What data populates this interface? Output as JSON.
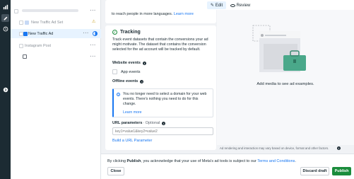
{
  "tree": {
    "items": [
      {
        "label": "New Traffic Ad Set"
      },
      {
        "label": "New Traffic Ad"
      },
      {
        "label": "Instagram Post"
      }
    ]
  },
  "editor": {
    "top_text": "to reach people in more languages.",
    "top_link": "Learn more",
    "tracking": {
      "title": "Tracking",
      "description": "Track event datasets that contain the conversions your ad might motivate. The dataset that contains the conversion selected for the ad account will be tracked by default.",
      "website_events": "Website events",
      "app_events": "App events",
      "offline_events": "Offline events",
      "notice": "You no longer need to select a domain for your web events. There's nothing you need to do for this change.",
      "notice_link": "Learn more",
      "url_params_label": "URL parameters",
      "url_params_optional": " · Optional",
      "url_params_placeholder": "key1=value1&key2=value2",
      "build_link": "Build a URL Parameter"
    }
  },
  "topbar": {
    "edit": "Edit",
    "review": "Review"
  },
  "preview": {
    "add_media": "Add media to see ad examples.",
    "note": "Ad rendering and interaction may vary based on device, format and other factors."
  },
  "footer": {
    "text_prefix": "By clicking ",
    "text_bold": "Publish",
    "text_suffix": ", you acknowledge that your use of Meta's ad tools is subject to our ",
    "terms_link": "Terms and Conditions",
    "text_end": ".",
    "close": "Close",
    "discard": "Discard draft",
    "publish": "Publish"
  },
  "colors": {
    "accent": "#1877f2",
    "publish": "#1b8c3c",
    "rail": "#1c2b33"
  }
}
